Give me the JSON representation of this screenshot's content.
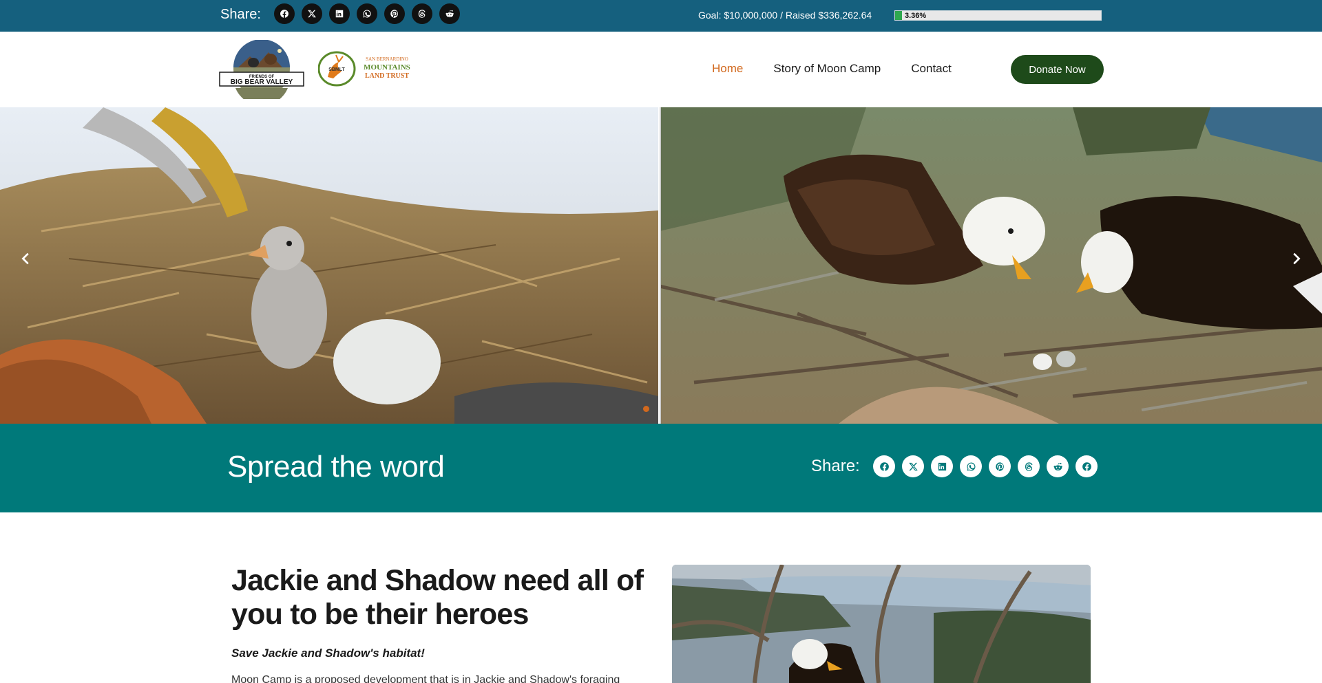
{
  "topbar": {
    "share_label": "Share:",
    "share_icons": [
      "facebook-icon",
      "x-icon",
      "linkedin-icon",
      "whatsapp-icon",
      "pinterest-icon",
      "threads-icon",
      "reddit-icon"
    ],
    "goal_text": "Goal: $10,000,000 / Raised $336,262.64",
    "progress_percent_label": "3.36%",
    "progress_fraction": 0.0336,
    "background_color": "#15607e"
  },
  "header": {
    "logos": [
      "friends-of-big-bear-valley-logo",
      "sbmlt-logo"
    ],
    "logo_fbbv_text": "FRIENDS OF BIG BEAR VALLEY",
    "logo_sbmlt_abbr": "SBMLT",
    "logo_sbmlt_name": "SAN BERNARDINO MOUNTAINS LAND TRUST",
    "nav": [
      {
        "label": "Home",
        "active": true
      },
      {
        "label": "Story of Moon Camp",
        "active": false
      },
      {
        "label": "Contact",
        "active": false
      }
    ],
    "donate_label": "Donate Now",
    "accent_color": "#d2691e",
    "donate_color": "#1e4a1a"
  },
  "hero": {
    "slides": [
      "eaglet-and-egg-in-snowy-nest-photo",
      "two-bald-eagles-at-nest-photo"
    ],
    "active_dot_color": "#d2691e"
  },
  "spread": {
    "title": "Spread the word",
    "share_label": "Share:",
    "share_icons": [
      "facebook-icon",
      "x-icon",
      "linkedin-icon",
      "whatsapp-icon",
      "pinterest-icon",
      "threads-icon",
      "reddit-icon",
      "facebook-icon"
    ],
    "background_color": "#00797a"
  },
  "content": {
    "title": "Jackie and Shadow need all of you to be their heroes",
    "subtitle": "Save Jackie and Shadow's habitat!",
    "body": "Moon Camp is a proposed development that is in Jackie and Shadow's foraging",
    "image": "bald-eagle-at-nest-above-lake-photo"
  }
}
